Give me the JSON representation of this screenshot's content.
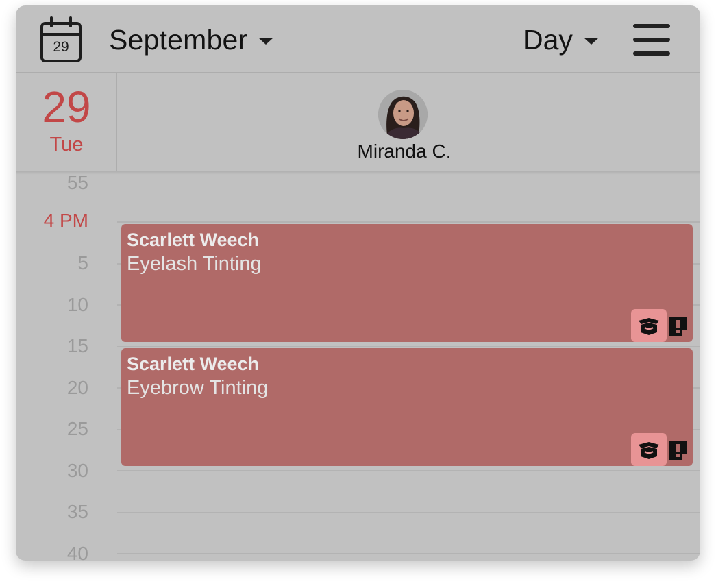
{
  "header": {
    "calendar_icon_day": "29",
    "month": "September",
    "view": "Day"
  },
  "day": {
    "number": "29",
    "weekday": "Tue"
  },
  "staff": {
    "name": "Miranda C."
  },
  "time_labels": [
    "55",
    "4 PM",
    "5",
    "10",
    "15",
    "20",
    "25",
    "30",
    "35",
    "40"
  ],
  "appointments": [
    {
      "client": "Scarlett Weech",
      "service": "Eyelash Tinting"
    },
    {
      "client": "Scarlett Weech",
      "service": "Eyebrow Tinting"
    }
  ],
  "colors": {
    "accent": "#c24747",
    "appointment": "#b06a68",
    "badge": "#e89495",
    "overlay_bg": "#c1c1c1"
  },
  "icons": {
    "calendar": "calendar-icon",
    "caret": "caret-down-icon",
    "menu": "hamburger-menu-icon",
    "product": "product-box-icon",
    "alert_note": "alert-note-icon"
  }
}
